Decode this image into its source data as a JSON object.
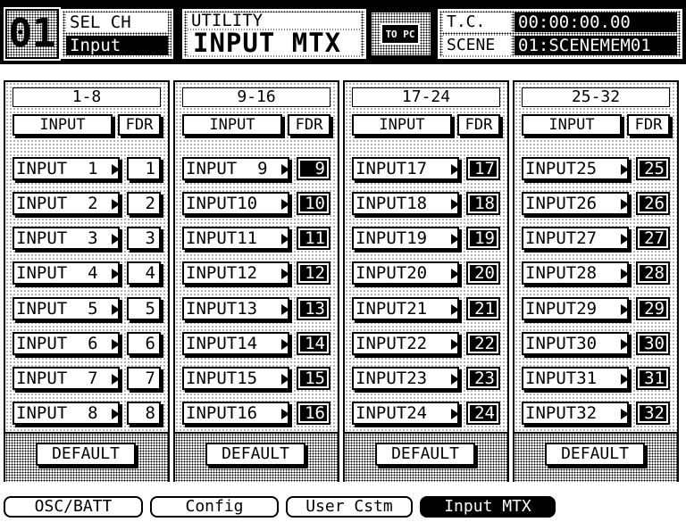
{
  "header": {
    "channel_number": "01",
    "sel_ch_label": "SEL CH",
    "sel_ch_value": "Input",
    "utility_label": "UTILITY",
    "page_title": "INPUT MTX",
    "to_pc_label": "TO PC",
    "tc_label": "T.C.",
    "tc_value": "00:00:00.00",
    "scene_label": "SCENE",
    "scene_value": "01:SCENEMEM01"
  },
  "columns": [
    {
      "header": "1-8",
      "tab_input": "INPUT",
      "tab_fdr": "FDR",
      "rows": [
        {
          "label": "INPUT  1",
          "fader": "1"
        },
        {
          "label": "INPUT  2",
          "fader": "2"
        },
        {
          "label": "INPUT  3",
          "fader": "3"
        },
        {
          "label": "INPUT  4",
          "fader": "4"
        },
        {
          "label": "INPUT  5",
          "fader": "5"
        },
        {
          "label": "INPUT  6",
          "fader": "6"
        },
        {
          "label": "INPUT  7",
          "fader": "7"
        },
        {
          "label": "INPUT  8",
          "fader": "8"
        }
      ],
      "default_label": "DEFAULT"
    },
    {
      "header": "9-16",
      "tab_input": "INPUT",
      "tab_fdr": "FDR",
      "rows": [
        {
          "label": "INPUT  9",
          "fader": "9"
        },
        {
          "label": "INPUT10",
          "fader": "10"
        },
        {
          "label": "INPUT11",
          "fader": "11"
        },
        {
          "label": "INPUT12",
          "fader": "12"
        },
        {
          "label": "INPUT13",
          "fader": "13"
        },
        {
          "label": "INPUT14",
          "fader": "14"
        },
        {
          "label": "INPUT15",
          "fader": "15"
        },
        {
          "label": "INPUT16",
          "fader": "16"
        }
      ],
      "default_label": "DEFAULT"
    },
    {
      "header": "17-24",
      "tab_input": "INPUT",
      "tab_fdr": "FDR",
      "rows": [
        {
          "label": "INPUT17",
          "fader": "17"
        },
        {
          "label": "INPUT18",
          "fader": "18"
        },
        {
          "label": "INPUT19",
          "fader": "19"
        },
        {
          "label": "INPUT20",
          "fader": "20"
        },
        {
          "label": "INPUT21",
          "fader": "21"
        },
        {
          "label": "INPUT22",
          "fader": "22"
        },
        {
          "label": "INPUT23",
          "fader": "23"
        },
        {
          "label": "INPUT24",
          "fader": "24"
        }
      ],
      "default_label": "DEFAULT"
    },
    {
      "header": "25-32",
      "tab_input": "INPUT",
      "tab_fdr": "FDR",
      "rows": [
        {
          "label": "INPUT25",
          "fader": "25"
        },
        {
          "label": "INPUT26",
          "fader": "26"
        },
        {
          "label": "INPUT27",
          "fader": "27"
        },
        {
          "label": "INPUT28",
          "fader": "28"
        },
        {
          "label": "INPUT29",
          "fader": "29"
        },
        {
          "label": "INPUT30",
          "fader": "30"
        },
        {
          "label": "INPUT31",
          "fader": "31"
        },
        {
          "label": "INPUT32",
          "fader": "32"
        }
      ],
      "default_label": "DEFAULT"
    }
  ],
  "bottom_tabs": [
    {
      "label": "OSC/BATT",
      "active": false
    },
    {
      "label": "Config",
      "active": false
    },
    {
      "label": "User Cstm",
      "active": false
    },
    {
      "label": "Input MTX",
      "active": true
    }
  ],
  "colors": {
    "foreground": "#000000",
    "background": "#ffffff"
  },
  "icons": {
    "row_arrow": "right-triangle-icon"
  }
}
